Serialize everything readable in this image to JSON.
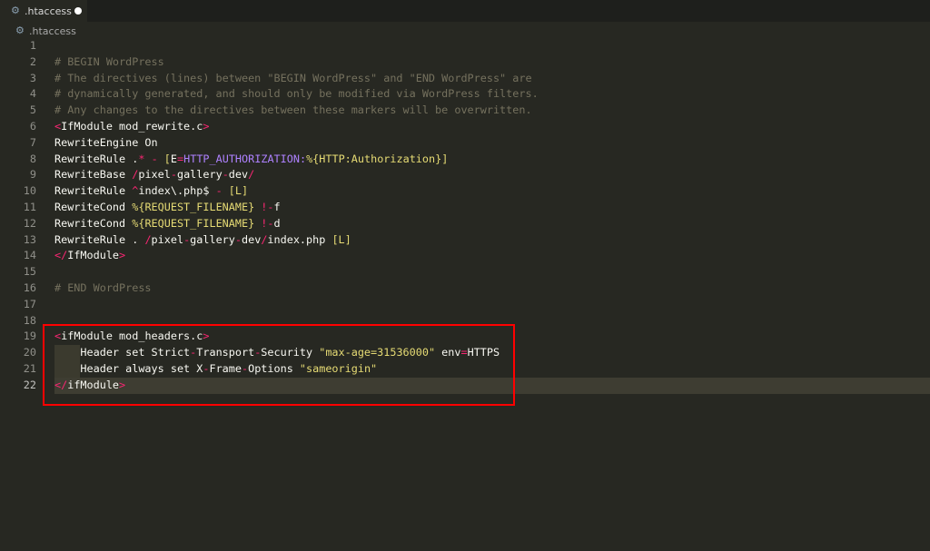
{
  "tab": {
    "label": ".htaccess",
    "icon": "gear-icon",
    "modified": true
  },
  "breadcrumb": {
    "label": ".htaccess",
    "icon": "gear-icon"
  },
  "editor": {
    "active_line": 22,
    "lines": [
      {
        "n": "1",
        "tokens": []
      },
      {
        "n": "2",
        "tokens": [
          {
            "t": "c",
            "v": "# BEGIN WordPress"
          }
        ]
      },
      {
        "n": "3",
        "tokens": [
          {
            "t": "c",
            "v": "# The directives (lines) between \"BEGIN WordPress\" and \"END WordPress\" are"
          }
        ]
      },
      {
        "n": "4",
        "tokens": [
          {
            "t": "c",
            "v": "# dynamically generated, and should only be modified via WordPress filters."
          }
        ]
      },
      {
        "n": "5",
        "tokens": [
          {
            "t": "c",
            "v": "# Any changes to the directives between these markers will be overwritten."
          }
        ]
      },
      {
        "n": "6",
        "tokens": [
          {
            "t": "t",
            "v": "<"
          },
          {
            "t": "w",
            "v": "IfModule mod_rewrite.c"
          },
          {
            "t": "t",
            "v": ">"
          }
        ]
      },
      {
        "n": "7",
        "tokens": [
          {
            "t": "w",
            "v": "RewriteEngine On"
          }
        ]
      },
      {
        "n": "8",
        "tokens": [
          {
            "t": "w",
            "v": "RewriteRule ."
          },
          {
            "t": "t",
            "v": "*"
          },
          {
            "t": "w",
            "v": " "
          },
          {
            "t": "t",
            "v": "-"
          },
          {
            "t": "w",
            "v": " "
          },
          {
            "t": "s",
            "v": "["
          },
          {
            "t": "w",
            "v": "E"
          },
          {
            "t": "t",
            "v": "="
          },
          {
            "t": "p",
            "v": "HTTP_AUTHORIZATION:"
          },
          {
            "t": "s",
            "v": "%{HTTP:Authorization}"
          },
          {
            "t": "s",
            "v": "]"
          }
        ]
      },
      {
        "n": "9",
        "tokens": [
          {
            "t": "w",
            "v": "RewriteBase "
          },
          {
            "t": "t",
            "v": "/"
          },
          {
            "t": "w",
            "v": "pixel"
          },
          {
            "t": "t",
            "v": "-"
          },
          {
            "t": "w",
            "v": "gallery"
          },
          {
            "t": "t",
            "v": "-"
          },
          {
            "t": "w",
            "v": "dev"
          },
          {
            "t": "t",
            "v": "/"
          }
        ]
      },
      {
        "n": "10",
        "tokens": [
          {
            "t": "w",
            "v": "RewriteRule "
          },
          {
            "t": "t",
            "v": "^"
          },
          {
            "t": "w",
            "v": "index\\.php$ "
          },
          {
            "t": "t",
            "v": "-"
          },
          {
            "t": "w",
            "v": " "
          },
          {
            "t": "s",
            "v": "[L]"
          }
        ]
      },
      {
        "n": "11",
        "tokens": [
          {
            "t": "w",
            "v": "RewriteCond "
          },
          {
            "t": "s",
            "v": "%{REQUEST_FILENAME}"
          },
          {
            "t": "w",
            "v": " "
          },
          {
            "t": "t",
            "v": "!-"
          },
          {
            "t": "w",
            "v": "f"
          }
        ]
      },
      {
        "n": "12",
        "tokens": [
          {
            "t": "w",
            "v": "RewriteCond "
          },
          {
            "t": "s",
            "v": "%{REQUEST_FILENAME}"
          },
          {
            "t": "w",
            "v": " "
          },
          {
            "t": "t",
            "v": "!-"
          },
          {
            "t": "w",
            "v": "d"
          }
        ]
      },
      {
        "n": "13",
        "tokens": [
          {
            "t": "w",
            "v": "RewriteRule . "
          },
          {
            "t": "t",
            "v": "/"
          },
          {
            "t": "w",
            "v": "pixel"
          },
          {
            "t": "t",
            "v": "-"
          },
          {
            "t": "w",
            "v": "gallery"
          },
          {
            "t": "t",
            "v": "-"
          },
          {
            "t": "w",
            "v": "dev"
          },
          {
            "t": "t",
            "v": "/"
          },
          {
            "t": "w",
            "v": "index.php "
          },
          {
            "t": "s",
            "v": "[L]"
          }
        ]
      },
      {
        "n": "14",
        "tokens": [
          {
            "t": "t",
            "v": "</"
          },
          {
            "t": "w",
            "v": "IfModule"
          },
          {
            "t": "t",
            "v": ">"
          }
        ]
      },
      {
        "n": "15",
        "tokens": []
      },
      {
        "n": "16",
        "tokens": [
          {
            "t": "c",
            "v": "# END WordPress"
          }
        ]
      },
      {
        "n": "17",
        "tokens": []
      },
      {
        "n": "18",
        "tokens": []
      },
      {
        "n": "19",
        "tokens": [
          {
            "t": "t",
            "v": "<"
          },
          {
            "t": "w",
            "v": "ifModule mod_headers.c"
          },
          {
            "t": "t",
            "v": ">"
          }
        ]
      },
      {
        "n": "20",
        "indent": true,
        "tokens": [
          {
            "t": "w",
            "v": "    Header set Strict"
          },
          {
            "t": "t",
            "v": "-"
          },
          {
            "t": "w",
            "v": "Transport"
          },
          {
            "t": "t",
            "v": "-"
          },
          {
            "t": "w",
            "v": "Security "
          },
          {
            "t": "s",
            "v": "\"max-age=31536000\""
          },
          {
            "t": "w",
            "v": " env"
          },
          {
            "t": "t",
            "v": "="
          },
          {
            "t": "w",
            "v": "HTTPS"
          }
        ]
      },
      {
        "n": "21",
        "indent": true,
        "tokens": [
          {
            "t": "w",
            "v": "    Header always set X"
          },
          {
            "t": "t",
            "v": "-"
          },
          {
            "t": "w",
            "v": "Frame"
          },
          {
            "t": "t",
            "v": "-"
          },
          {
            "t": "w",
            "v": "Options "
          },
          {
            "t": "s",
            "v": "\"sameorigin\""
          }
        ]
      },
      {
        "n": "22",
        "tokens": [
          {
            "t": "t",
            "v": "</"
          },
          {
            "t": "w",
            "v": "ifModule"
          },
          {
            "t": "t",
            "v": ">"
          }
        ]
      }
    ]
  },
  "annotation": {
    "label": "highlighted-block",
    "color": "#ff0000",
    "lines": [
      19,
      22
    ]
  }
}
